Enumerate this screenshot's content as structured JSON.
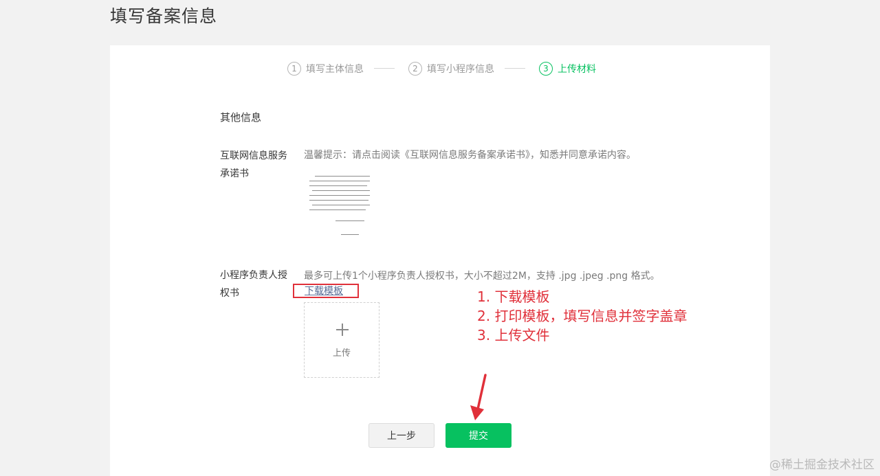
{
  "page_title": "填写备案信息",
  "steps": [
    {
      "num": "1",
      "label": "填写主体信息",
      "state": "done"
    },
    {
      "num": "2",
      "label": "填写小程序信息",
      "state": "done"
    },
    {
      "num": "3",
      "label": "上传材料",
      "state": "active"
    }
  ],
  "section_title": "其他信息",
  "fields": {
    "commitment": {
      "label": "互联网信息服务承诺书",
      "tip": "温馨提示：请点击阅读《互联网信息服务备案承诺书》，知悉并同意承诺内容。"
    },
    "authorization": {
      "label": "小程序负责人授权书",
      "hint": "最多可上传1个小程序负责人授权书，大小不超过2M，支持 .jpg .jpeg .png 格式。",
      "download_label": "下载模板",
      "upload_label": "上传"
    }
  },
  "annotation": [
    "1. 下载模板",
    "2. 打印模板，填写信息并签字盖章",
    "3. 上传文件"
  ],
  "buttons": {
    "prev": "上一步",
    "submit": "提交"
  },
  "watermark": "@稀土掘金技术社区",
  "colors": {
    "accent": "#07c160",
    "annotation": "#e0303a",
    "link": "#576b95"
  }
}
